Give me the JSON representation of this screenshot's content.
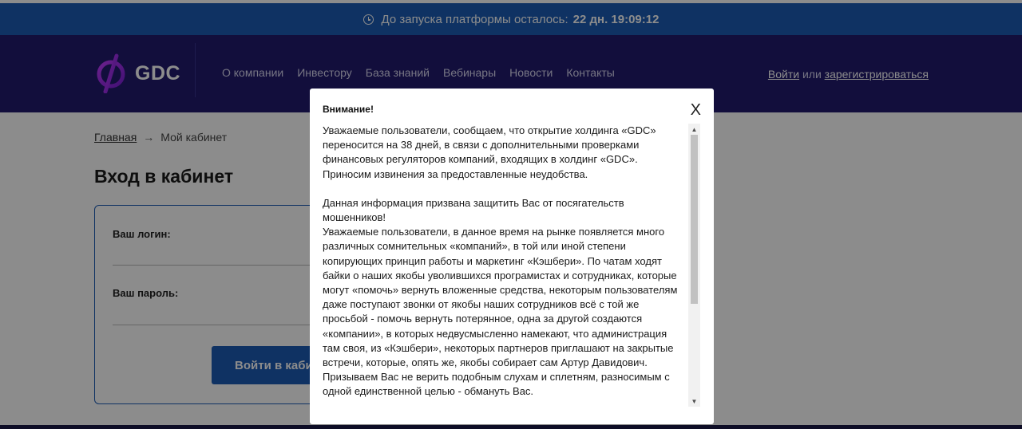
{
  "countdown": {
    "text": "До запуска платформы осталось:",
    "value": "22 дн. 19:09:12",
    "icon": "clock-icon"
  },
  "header": {
    "logo_text": "GDC",
    "logo_icon": "gdc-coin-logo-icon",
    "nav": [
      "О компании",
      "Инвестору",
      "База знаний",
      "Вебинары",
      "Новости",
      "Контакты"
    ],
    "auth": {
      "login": "Войти",
      "or": "или",
      "register": "зарегистрироваться"
    }
  },
  "main": {
    "breadcrumb": {
      "home": "Главная",
      "arrow": "→",
      "current": "Мой кабинет"
    },
    "title": "Вход в кабинет",
    "form": {
      "login_label": "Ваш логин:",
      "password_label": "Ваш пароль:",
      "submit_label": "Войти в кабинет"
    }
  },
  "modal": {
    "title": "Внимание!",
    "close_label": "X",
    "paragraphs": [
      "Уважаемые пользователи, сообщаем, что открытие холдинга «GDC» переносится на 38 дней, в связи с дополнительными проверками финансовых регуляторов компаний, входящих в холдинг «GDC». Приносим извинения за предоставленные неудобства.",
      "",
      "Данная информация призвана защитить Вас от посягательств мошенников!",
      "Уважаемые пользователи, в данное время на рынке появляется много различных сомнительных «компаний», в той или иной степени копирующих принцип работы и маркетинг «Кэшбери». По чатам ходят байки о наших якобы уволившихся програмистах и сотрудниках, которые могут «помочь» вернуть вложенные средства, некоторым пользователям даже поступают звонки от якобы наших сотрудников всё с той же просьбой - помочь вернуть потерянное, одна за другой создаются «компании», в которых недвусмысленно намекают, что администрация там своя, из «Кэшбери», некоторых партнеров приглашают на закрытые встречи, которые, опять же, якобы собирает сам Артур Давидович.",
      "Призываем Вас не верить подобным слухам и сплетням, разносимым с одной единственной целью - обмануть Вас."
    ]
  },
  "colors": {
    "countdown_bg": "#1c5cb4",
    "header_bg": "#221b6e",
    "accent": "#1c5cb4",
    "logo_purple": "#a020f0"
  }
}
